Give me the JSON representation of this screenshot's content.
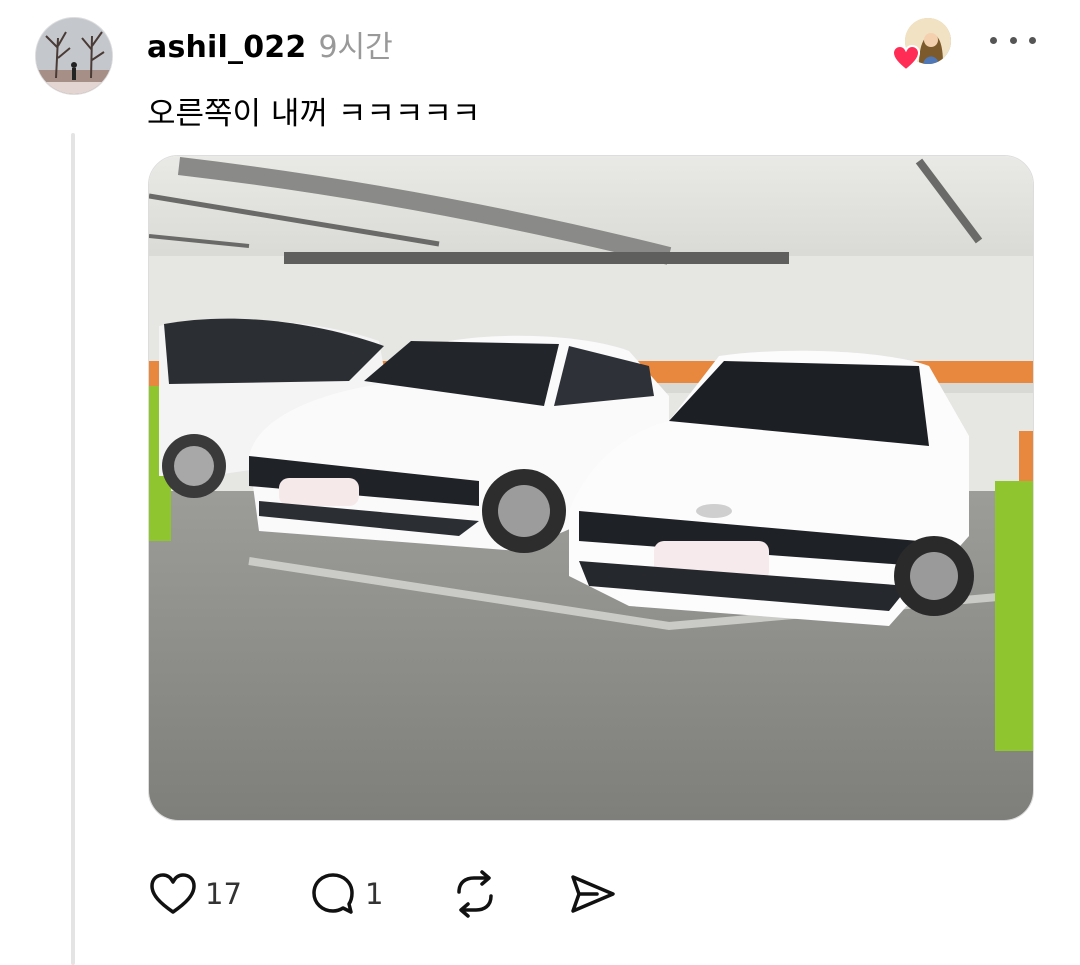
{
  "post": {
    "username": "ashil_022",
    "time": "9시간",
    "text": "오른쪽이 내꺼 ㅋㅋㅋㅋㅋ"
  },
  "actions": {
    "like_count": "17",
    "comment_count": "1"
  },
  "icons": {
    "heart": "heart-icon",
    "comment": "comment-icon",
    "repost": "repost-icon",
    "share": "share-icon",
    "more": "more-icon"
  },
  "colors": {
    "accent_heart": "#ff2d55",
    "secondary_text": "#999999",
    "thread_line": "#e4e4e4"
  }
}
